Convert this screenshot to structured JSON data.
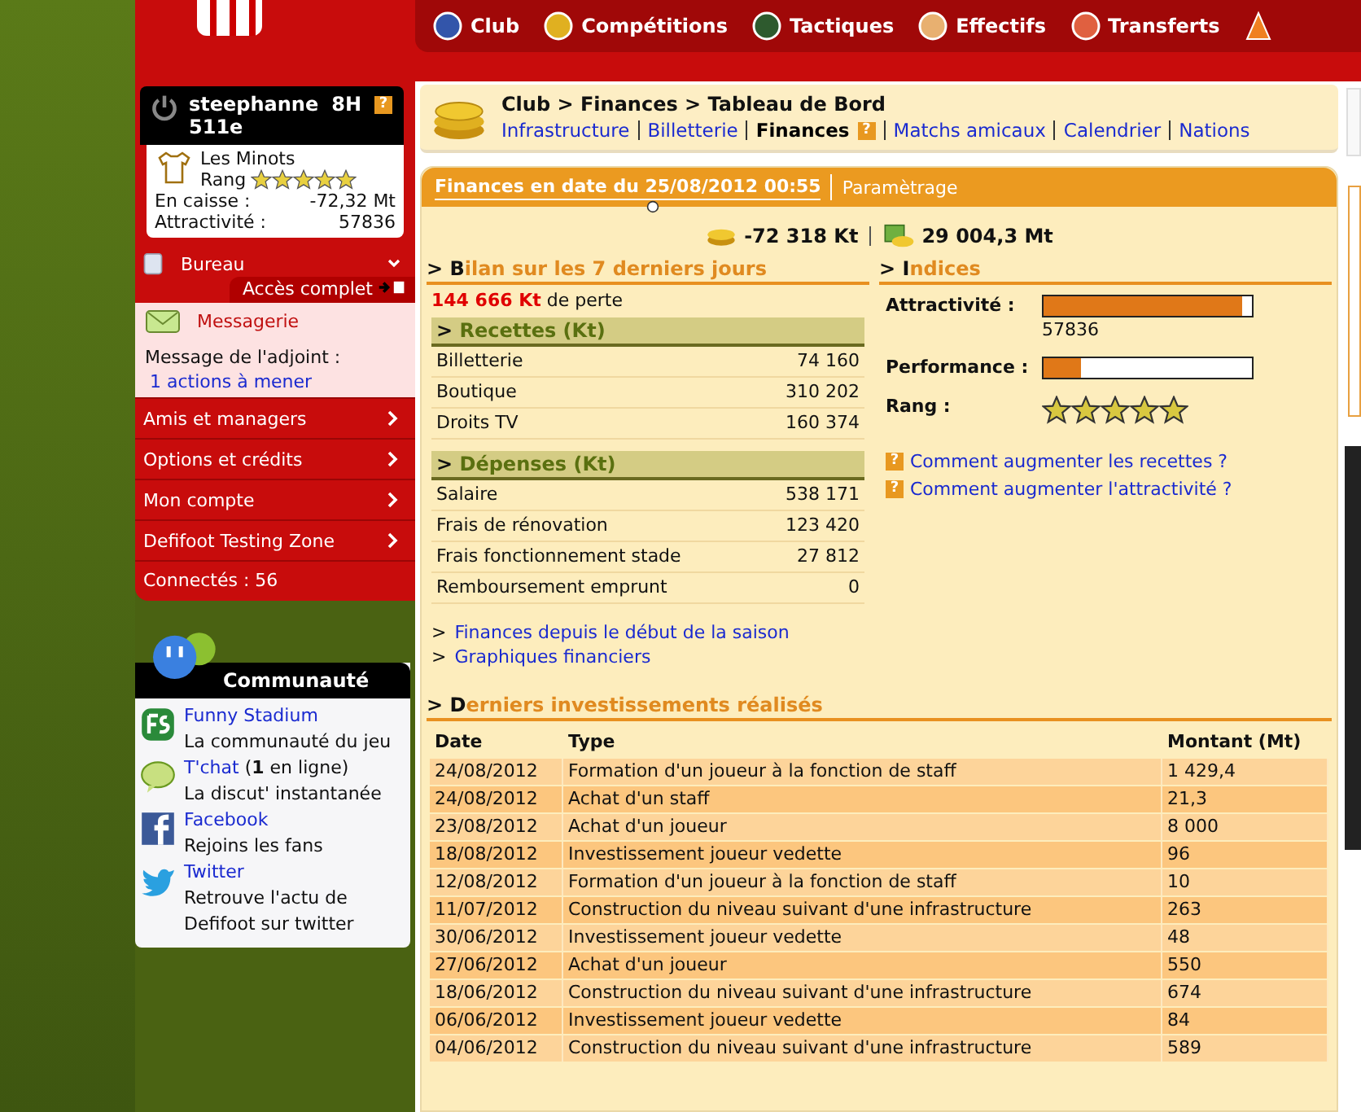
{
  "nav": {
    "items": [
      {
        "label": "Club",
        "kind": "club"
      },
      {
        "label": "Compétitions",
        "kind": "cup"
      },
      {
        "label": "Tactiques",
        "kind": "board"
      },
      {
        "label": "Effectifs",
        "kind": "player"
      },
      {
        "label": "Transferts",
        "kind": "transfer"
      }
    ]
  },
  "user": {
    "name": "steephanne",
    "hours": "8H",
    "help": "?",
    "rank": "511e",
    "team": "Les Minots",
    "rank_label": "Rang",
    "stars": 5,
    "cash_label": "En caisse :",
    "cash": "-72,32 Mt",
    "attr_label": "Attractivité :",
    "attr": "57836"
  },
  "office": {
    "title": "Bureau",
    "access": "Accès complet",
    "messages": "Messagerie",
    "deputy_label": "Message de l'adjoint :",
    "deputy_link": "1 actions à mener"
  },
  "menu": [
    {
      "label": "Amis et managers"
    },
    {
      "label": "Options et crédits"
    },
    {
      "label": "Mon compte"
    },
    {
      "label": "Defifoot Testing Zone"
    }
  ],
  "online": "Connectés : 56",
  "community": {
    "title": "Communauté",
    "items": [
      {
        "kind": "fs",
        "link": "Funny Stadium",
        "desc": "La communauté du jeu"
      },
      {
        "kind": "chat",
        "link": "T'chat",
        "extra": "(**1** en ligne)",
        "desc": "La discut' instantanée"
      },
      {
        "kind": "facebook",
        "link": "Facebook",
        "desc": "Rejoins les fans"
      },
      {
        "kind": "twitter",
        "link": "Twitter",
        "desc": "Retrouve l'actu de Defifoot sur twitter"
      }
    ]
  },
  "breadcrumb": {
    "path": "Club > Finances > Tableau de Bord",
    "links": [
      {
        "label": "Infrastructure",
        "selected": false
      },
      {
        "label": "Billetterie",
        "selected": false
      },
      {
        "label": "Finances",
        "selected": true,
        "help": "?"
      },
      {
        "label": "Matchs amicaux",
        "selected": false
      },
      {
        "label": "Calendrier",
        "selected": false
      },
      {
        "label": "Nations",
        "selected": false
      }
    ]
  },
  "finance": {
    "tabs": [
      {
        "label": "Finances en date du 25/08/2012 00:55",
        "selected": true
      },
      {
        "label": "Paramètrage",
        "selected": false
      }
    ],
    "balance": {
      "cash": "-72 318 Kt",
      "value": "29 004,3 Mt"
    }
  },
  "bilan": {
    "marker": ">",
    "title": "Bilan sur les 7 derniers jours",
    "loss_amount": "144 666 Kt",
    "loss_text": "de perte",
    "groups": [
      {
        "marker": ">",
        "title": "Recettes (Kt)",
        "rows": [
          {
            "label": "Billetterie",
            "value": "74 160"
          },
          {
            "label": "Boutique",
            "value": "310 202"
          },
          {
            "label": "Droits TV",
            "value": "160 374"
          }
        ]
      },
      {
        "marker": ">",
        "title": "Dépenses (Kt)",
        "rows": [
          {
            "label": "Salaire",
            "value": "538 171"
          },
          {
            "label": "Frais de rénovation",
            "value": "123 420"
          },
          {
            "label": "Frais fonctionnement stade",
            "value": "27 812"
          },
          {
            "label": "Remboursement emprunt",
            "value": "0"
          }
        ]
      }
    ],
    "links": [
      {
        "marker": ">",
        "label": "Finances depuis le début de la saison"
      },
      {
        "marker": ">",
        "label": "Graphiques financiers"
      }
    ]
  },
  "indices": {
    "marker": ">",
    "title": "Indices",
    "items": [
      {
        "kind": "bar",
        "label": "Attractivité :",
        "level": 0.95,
        "reading": "57836"
      },
      {
        "kind": "bar",
        "label": "Performance :",
        "level": 0.18
      },
      {
        "kind": "stars",
        "label": "Rang :",
        "stars": 5
      }
    ],
    "help_links": [
      {
        "icon": "?",
        "label": "Comment augmenter les recettes ?"
      },
      {
        "icon": "?",
        "label": "Comment augmenter l'attractivité ?"
      }
    ]
  },
  "investments": {
    "marker": ">",
    "title": "Derniers investissements réalisés",
    "columns": [
      "Date",
      "Type",
      "Montant (Mt)"
    ],
    "rows": [
      [
        "24/08/2012",
        "Formation d'un joueur à la fonction de staff",
        "1 429,4"
      ],
      [
        "24/08/2012",
        "Achat d'un staff",
        "21,3"
      ],
      [
        "23/08/2012",
        "Achat d'un joueur",
        "8 000"
      ],
      [
        "18/08/2012",
        "Investissement joueur vedette",
        "96"
      ],
      [
        "12/08/2012",
        "Formation d'un joueur à la fonction de staff",
        "10"
      ],
      [
        "11/07/2012",
        "Construction du niveau suivant d'une infrastructure",
        "263"
      ],
      [
        "30/06/2012",
        "Investissement joueur vedette",
        "48"
      ],
      [
        "27/06/2012",
        "Achat d'un joueur",
        "550"
      ],
      [
        "18/06/2012",
        "Construction du niveau suivant d'une infrastructure",
        "674"
      ],
      [
        "06/06/2012",
        "Investissement joueur vedette",
        "84"
      ],
      [
        "04/06/2012",
        "Construction du niveau suivant d'une infrastructure",
        "589"
      ]
    ]
  }
}
